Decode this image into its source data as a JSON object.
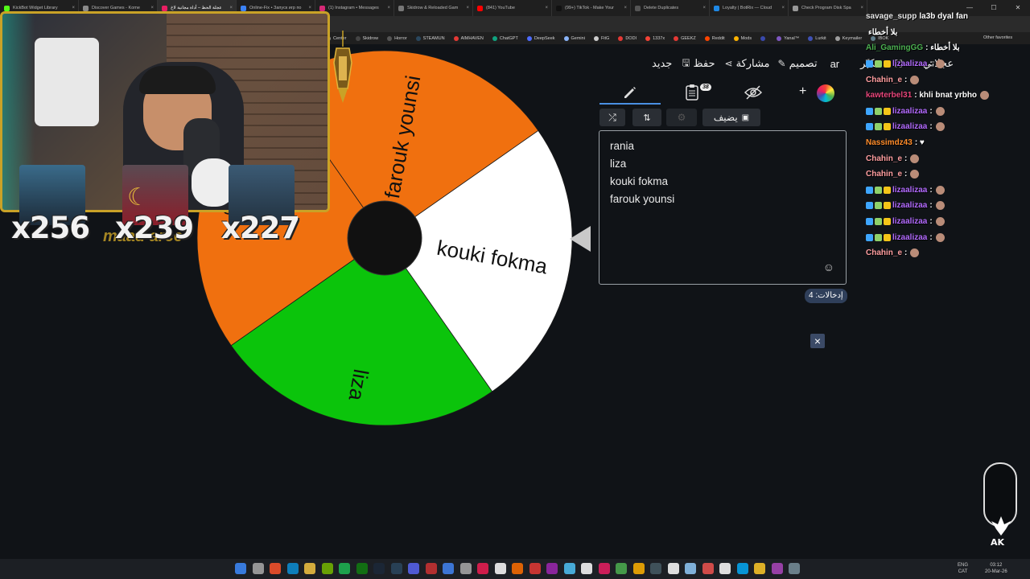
{
  "browser": {
    "tabs": [
      {
        "title": "KickBot Widget Library",
        "color": "#53fc18"
      },
      {
        "title": "Discover Games - Kome",
        "color": "#8a8a8a"
      },
      {
        "title": "عجلة الحظ – أداة مجانية لاخ",
        "color": "#e91e63",
        "active": true
      },
      {
        "title": "Online-Fix • Запуск игр по",
        "color": "#3b82f6"
      },
      {
        "title": "(1) Instagram • Messages",
        "color": "#d62976"
      },
      {
        "title": "Skidrow & Reloaded Gam",
        "color": "#777777"
      },
      {
        "title": "(841) YouTube",
        "color": "#ff0000"
      },
      {
        "title": "(99+) TikTok - Make Your",
        "color": "#111111"
      },
      {
        "title": "Delete Duplicates",
        "color": "#555555"
      },
      {
        "title": "Loyalty | BotRix — Cloud",
        "color": "#1e88e5"
      },
      {
        "title": "Check Program Disk Spa",
        "color": "#999999"
      }
    ],
    "bookmarks": [
      {
        "label": "Center",
        "color": "#888888"
      },
      {
        "label": "Skidrow",
        "color": "#444444"
      },
      {
        "label": "Horror",
        "color": "#555555"
      },
      {
        "label": "STEAMUN",
        "color": "#2a475e"
      },
      {
        "label": "AIMHAVEN",
        "color": "#e53935"
      },
      {
        "label": "ChatGPT",
        "color": "#10a37f"
      },
      {
        "label": "DeepSeek",
        "color": "#4d6bfe"
      },
      {
        "label": "Gemini",
        "color": "#8ab4f8"
      },
      {
        "label": "FitG",
        "color": "#cccccc"
      },
      {
        "label": "DODI",
        "color": "#e53935"
      },
      {
        "label": "1337x",
        "color": "#f44336"
      },
      {
        "label": "GEEKZ",
        "color": "#e53935"
      },
      {
        "label": "Reddit",
        "color": "#ff4500"
      },
      {
        "label": "Mods",
        "color": "#ffb300"
      },
      {
        "label": "",
        "color": "#3949ab"
      },
      {
        "label": "Yanal™",
        "color": "#7e57c2"
      },
      {
        "label": "Lurkit",
        "color": "#3f51b5"
      },
      {
        "label": "Keymailer",
        "color": "#9e9e9e"
      },
      {
        "label": "IBOK",
        "color": "#607d8b"
      }
    ],
    "other_favorites": "Other favorites"
  },
  "stream": {
    "multipliers": [
      "x256",
      "x239",
      "x227"
    ],
    "overlay_text": "maad  arce"
  },
  "menu": {
    "new": "جديد",
    "save": "حفظ",
    "share": "مشاركة",
    "design": "تصميم",
    "lang": "ar",
    "more": "مكبّر",
    "wheel": "عجلاتي"
  },
  "editor": {
    "count_badge": "38",
    "add_image": "يضيف",
    "entries": [
      "rania",
      "liza",
      "kouki fokma",
      "farouk younsi"
    ],
    "entries_count_label": "إدخالات: 4"
  },
  "wheel": {
    "segments": [
      {
        "label": "kouki fokma",
        "color": "#ffffff",
        "text": "#111111"
      },
      {
        "label": "liza",
        "color": "#0bc40b",
        "text": "#111111"
      },
      {
        "label": "rania",
        "color": "#f0700f",
        "text": "#111111"
      },
      {
        "label": "farouk younsi",
        "color": "#f0700f",
        "text": "#111111"
      }
    ]
  },
  "chat": [
    {
      "user": "savage_supp",
      "color": "#e8e8e8",
      "msg": "la3b dyal fan",
      "badges": 0
    },
    {
      "user": "",
      "color": "#ffffff",
      "msg": "بلا أخطاء",
      "badges": 0
    },
    {
      "user": "Ali_GamingGG",
      "color": "#4caf50",
      "msg": ": بلا أخطاء",
      "badges": 0
    },
    {
      "user": "lizaalizaa",
      "color": "#b36bff",
      "msg": ":",
      "badges": 3,
      "avatar": true
    },
    {
      "user": "Chahin_e",
      "color": "#ff9ea0",
      "msg": ":",
      "badges": 0,
      "avatar": true
    },
    {
      "user": "kawterbel31",
      "color": "#e6457a",
      "msg": ": khli bnat yrbho",
      "badges": 0,
      "avatar": true
    },
    {
      "user": "lizaalizaa",
      "color": "#b36bff",
      "msg": ":",
      "badges": 3,
      "avatar": true
    },
    {
      "user": "lizaalizaa",
      "color": "#b36bff",
      "msg": ":",
      "badges": 3,
      "avatar": true
    },
    {
      "user": "Nassimdz43",
      "color": "#ff8c2a",
      "msg": ": ♥",
      "badges": 0
    },
    {
      "user": "Chahin_e",
      "color": "#ff9ea0",
      "msg": ":",
      "badges": 0,
      "avatar": true
    },
    {
      "user": "Chahin_e",
      "color": "#ff9ea0",
      "msg": ":",
      "badges": 0,
      "avatar": true
    },
    {
      "user": "lizaalizaa",
      "color": "#b36bff",
      "msg": ":",
      "badges": 3,
      "avatar": true
    },
    {
      "user": "lizaalizaa",
      "color": "#b36bff",
      "msg": ":",
      "badges": 3,
      "avatar": true
    },
    {
      "user": "lizaalizaa",
      "color": "#b36bff",
      "msg": ":",
      "badges": 3,
      "avatar": true
    },
    {
      "user": "lizaalizaa",
      "color": "#b36bff",
      "msg": ":",
      "badges": 3,
      "avatar": true
    },
    {
      "user": "Chahin_e",
      "color": "#ff9ea0",
      "msg": ":",
      "badges": 0,
      "avatar": true
    }
  ],
  "logo": {
    "text": "AK"
  },
  "taskbar": {
    "icons": [
      "start-icon",
      "search-icon",
      "brave-icon",
      "edge-icon",
      "files-icon",
      "nvidia-icon",
      "spotify-icon",
      "xbox-icon",
      "steam-icon",
      "steam-icon",
      "discord-icon",
      "game-icon",
      "chrome-icon",
      "obs-icon",
      "tiktok-icon",
      "app-icon",
      "app-icon",
      "app-icon",
      "app-icon",
      "app-icon",
      "app-icon",
      "app-icon",
      "app-icon",
      "app-icon",
      "app-icon",
      "app-icon",
      "app-icon",
      "app-icon",
      "app-icon",
      "app-icon",
      "app-icon",
      "app-icon",
      "app-icon"
    ],
    "lang_top": "ENG",
    "lang_bottom": "CAT",
    "time": "03:12",
    "date": "20-Mar-26"
  }
}
